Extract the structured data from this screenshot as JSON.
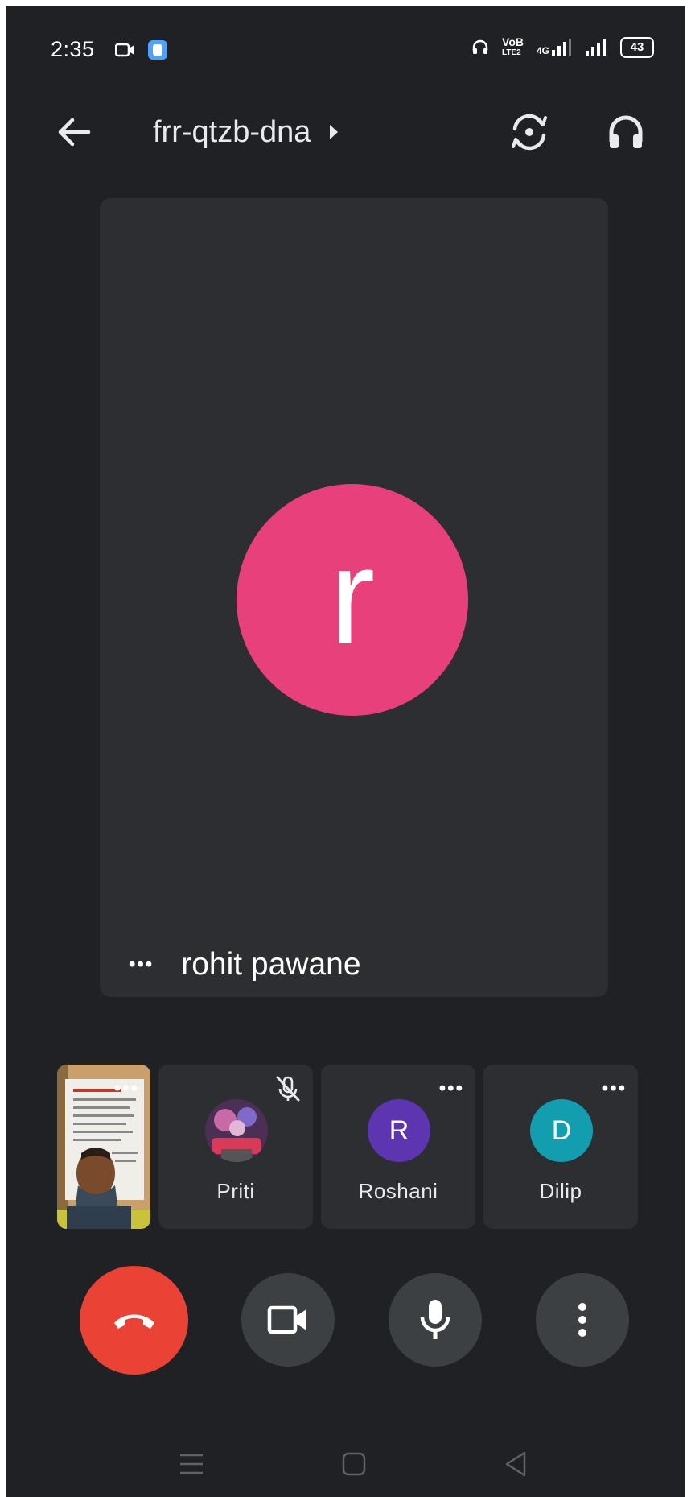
{
  "status_bar": {
    "time": "2:35",
    "volte_line1": "VoB",
    "volte_line2": "LTE2",
    "network": "4G",
    "battery": "43"
  },
  "app_bar": {
    "meeting_code": "frr-qtzb-dna"
  },
  "main_tile": {
    "avatar_letter": "r",
    "avatar_color": "#e8407a",
    "participant_name": "rohit pawane",
    "more_dots": "•••"
  },
  "participants": [
    {
      "name": "Priti",
      "avatar_type": "photo",
      "muted": true
    },
    {
      "name": "Roshani",
      "avatar_letter": "R",
      "avatar_color": "#5e35b1",
      "more_dots": "•••"
    },
    {
      "name": "Dilip",
      "avatar_letter": "D",
      "avatar_color": "#129eaf",
      "more_dots": "•••"
    }
  ],
  "self_tile": {
    "more_dots": "•••"
  },
  "controls": {
    "hangup_color": "#ea4335",
    "icons": [
      "phone-hangup-icon",
      "videocam-icon",
      "mic-icon",
      "more-vert-icon"
    ]
  },
  "nav_bar": {
    "icons": [
      "menu-icon",
      "home-icon",
      "back-triangle-icon"
    ]
  }
}
